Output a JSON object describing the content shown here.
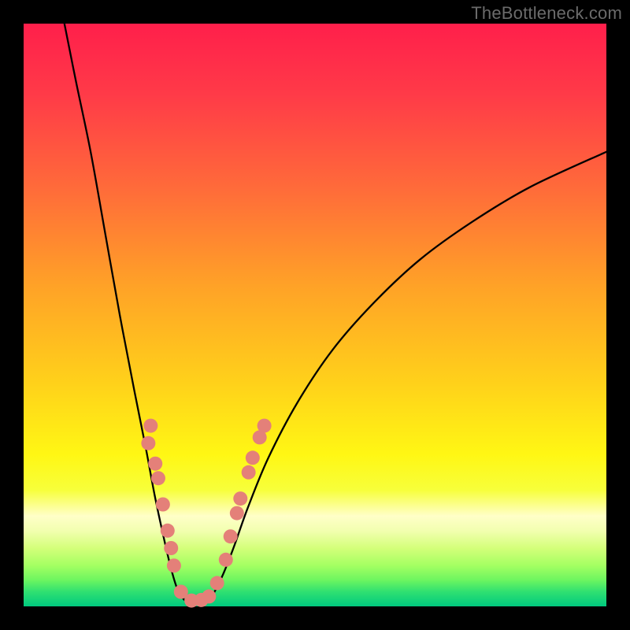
{
  "watermark": "TheBottleneck.com",
  "chart_data": {
    "type": "line",
    "title": "",
    "xlabel": "",
    "ylabel": "",
    "xlim": [
      0,
      100
    ],
    "ylim": [
      0,
      100
    ],
    "grid": false,
    "legend": false,
    "background_gradient": {
      "stops": [
        {
          "pos": 0.0,
          "color": "#ff1f4b"
        },
        {
          "pos": 0.12,
          "color": "#ff3a48"
        },
        {
          "pos": 0.28,
          "color": "#ff6a3a"
        },
        {
          "pos": 0.45,
          "color": "#ffa227"
        },
        {
          "pos": 0.62,
          "color": "#ffd21a"
        },
        {
          "pos": 0.74,
          "color": "#fff714"
        },
        {
          "pos": 0.8,
          "color": "#f7ff3a"
        },
        {
          "pos": 0.845,
          "color": "#ffffc8"
        },
        {
          "pos": 0.87,
          "color": "#f2ffb0"
        },
        {
          "pos": 0.9,
          "color": "#d4ff7a"
        },
        {
          "pos": 0.93,
          "color": "#a4ff62"
        },
        {
          "pos": 0.955,
          "color": "#6cf560"
        },
        {
          "pos": 0.975,
          "color": "#2fe071"
        },
        {
          "pos": 1.0,
          "color": "#00c97e"
        }
      ]
    },
    "series": [
      {
        "name": "bottleneck-curve",
        "stroke": "#000000",
        "stroke_width": 2.3,
        "points": [
          {
            "x": 7.0,
            "y": 100.0
          },
          {
            "x": 9.0,
            "y": 90.0
          },
          {
            "x": 11.5,
            "y": 78.0
          },
          {
            "x": 14.0,
            "y": 64.0
          },
          {
            "x": 16.5,
            "y": 50.0
          },
          {
            "x": 19.0,
            "y": 37.0
          },
          {
            "x": 21.0,
            "y": 27.0
          },
          {
            "x": 22.5,
            "y": 19.0
          },
          {
            "x": 24.0,
            "y": 12.0
          },
          {
            "x": 25.3,
            "y": 6.5
          },
          {
            "x": 26.5,
            "y": 2.7
          },
          {
            "x": 28.0,
            "y": 0.8
          },
          {
            "x": 30.0,
            "y": 0.6
          },
          {
            "x": 32.0,
            "y": 1.4
          },
          {
            "x": 34.0,
            "y": 5.0
          },
          {
            "x": 36.0,
            "y": 10.0
          },
          {
            "x": 38.5,
            "y": 17.0
          },
          {
            "x": 42.0,
            "y": 25.5
          },
          {
            "x": 47.0,
            "y": 35.0
          },
          {
            "x": 53.0,
            "y": 44.0
          },
          {
            "x": 60.0,
            "y": 52.0
          },
          {
            "x": 68.0,
            "y": 59.5
          },
          {
            "x": 77.0,
            "y": 66.0
          },
          {
            "x": 87.0,
            "y": 72.0
          },
          {
            "x": 100.0,
            "y": 78.0
          }
        ]
      }
    ],
    "scatter": {
      "name": "measured-points",
      "fill": "#e48079",
      "radius": 9,
      "points": [
        {
          "x": 21.8,
          "y": 31.0
        },
        {
          "x": 21.4,
          "y": 28.0
        },
        {
          "x": 22.6,
          "y": 24.5
        },
        {
          "x": 23.1,
          "y": 22.0
        },
        {
          "x": 23.9,
          "y": 17.5
        },
        {
          "x": 24.7,
          "y": 13.0
        },
        {
          "x": 25.3,
          "y": 10.0
        },
        {
          "x": 25.8,
          "y": 7.0
        },
        {
          "x": 27.0,
          "y": 2.5
        },
        {
          "x": 28.8,
          "y": 1.0
        },
        {
          "x": 30.5,
          "y": 1.1
        },
        {
          "x": 31.8,
          "y": 1.7
        },
        {
          "x": 33.2,
          "y": 4.0
        },
        {
          "x": 34.7,
          "y": 8.0
        },
        {
          "x": 35.5,
          "y": 12.0
        },
        {
          "x": 36.6,
          "y": 16.0
        },
        {
          "x": 37.2,
          "y": 18.5
        },
        {
          "x": 38.6,
          "y": 23.0
        },
        {
          "x": 39.3,
          "y": 25.5
        },
        {
          "x": 40.5,
          "y": 29.0
        },
        {
          "x": 41.3,
          "y": 31.0
        }
      ]
    }
  }
}
